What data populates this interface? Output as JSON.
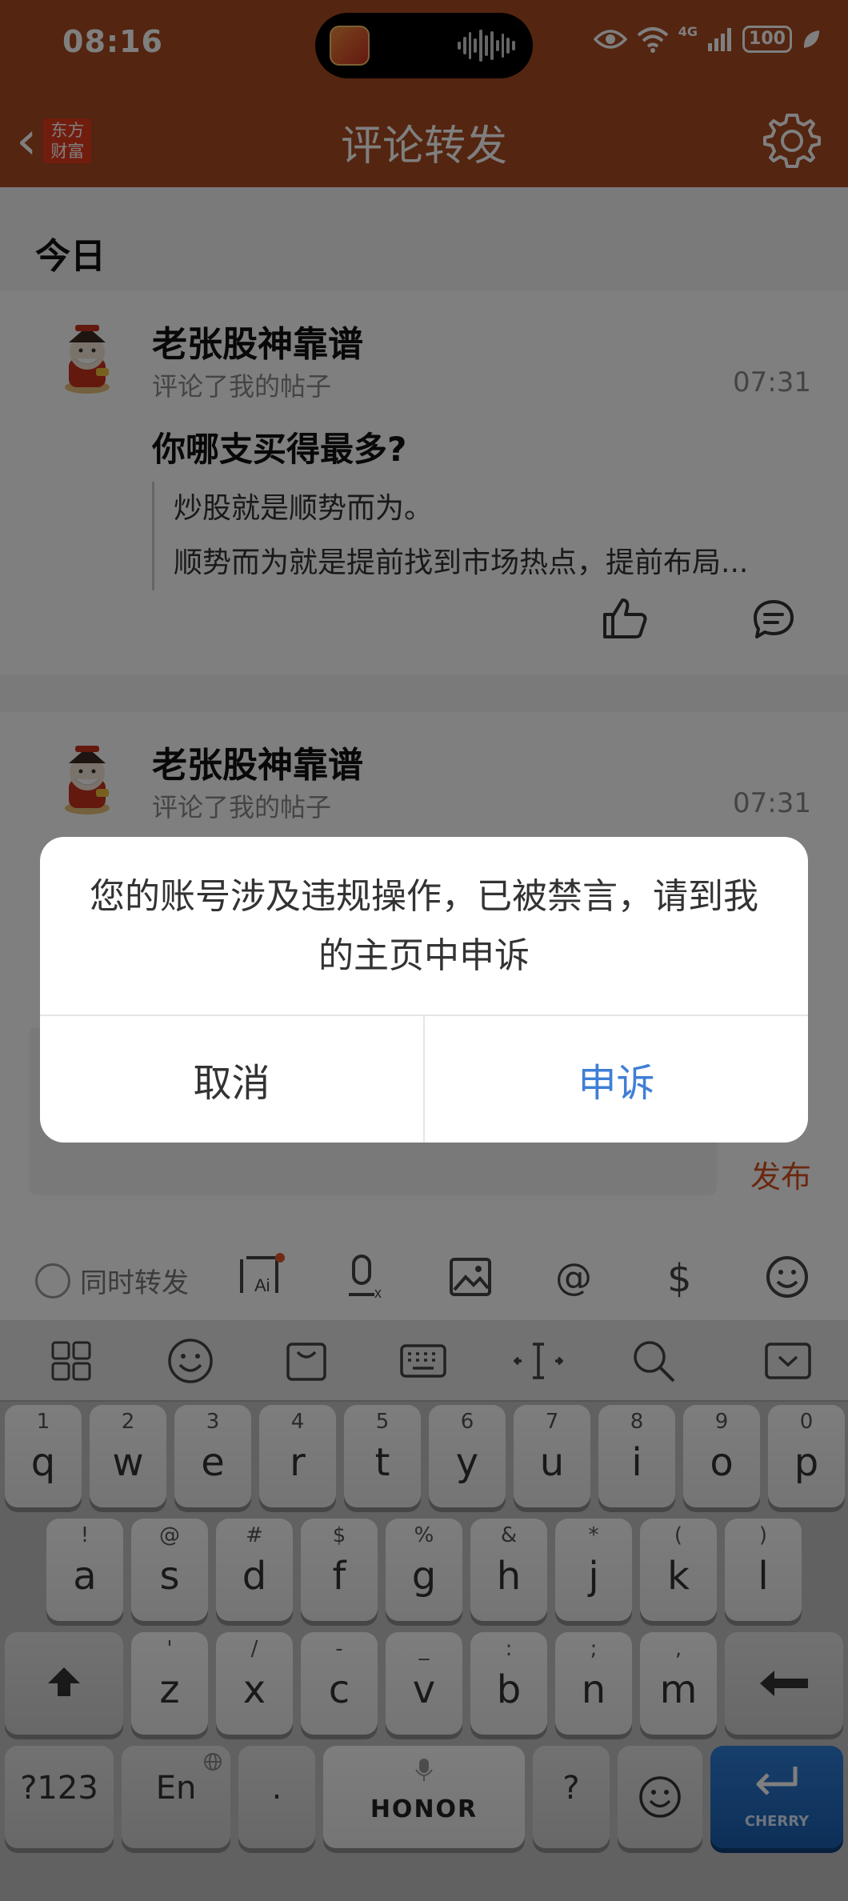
{
  "status": {
    "time": "08:16",
    "network": "4G",
    "battery": "100"
  },
  "header": {
    "title": "评论转发",
    "logo_line1": "东方",
    "logo_line2": "财富"
  },
  "section": {
    "label": "今日"
  },
  "comments": [
    {
      "name": "老张股神靠谱",
      "action": "评论了我的帖子",
      "time": "07:31",
      "post_title": "你哪支买得最多?",
      "quote_line1": "炒股就是顺势而为。",
      "quote_line2": "顺势而为就是提前找到市场热点，提前布局..."
    },
    {
      "name": "老张股神靠谱",
      "action": "评论了我的帖子",
      "time": "07:31"
    }
  ],
  "compose": {
    "publish_label": "发布",
    "sync_label": "同时转发"
  },
  "keyboard": {
    "row1": [
      {
        "hint": "1",
        "key": "q"
      },
      {
        "hint": "2",
        "key": "w"
      },
      {
        "hint": "3",
        "key": "e"
      },
      {
        "hint": "4",
        "key": "r"
      },
      {
        "hint": "5",
        "key": "t"
      },
      {
        "hint": "6",
        "key": "y"
      },
      {
        "hint": "7",
        "key": "u"
      },
      {
        "hint": "8",
        "key": "i"
      },
      {
        "hint": "9",
        "key": "o"
      },
      {
        "hint": "0",
        "key": "p"
      }
    ],
    "row2": [
      {
        "hint": "!",
        "key": "a"
      },
      {
        "hint": "@",
        "key": "s"
      },
      {
        "hint": "#",
        "key": "d"
      },
      {
        "hint": "$",
        "key": "f"
      },
      {
        "hint": "%",
        "key": "g"
      },
      {
        "hint": "&",
        "key": "h"
      },
      {
        "hint": "*",
        "key": "j"
      },
      {
        "hint": "(",
        "key": "k"
      },
      {
        "hint": ")",
        "key": "l"
      }
    ],
    "row3": [
      {
        "hint": "'",
        "key": "z"
      },
      {
        "hint": "/",
        "key": "x"
      },
      {
        "hint": "-",
        "key": "c"
      },
      {
        "hint": "_",
        "key": "v"
      },
      {
        "hint": ":",
        "key": "b"
      },
      {
        "hint": ";",
        "key": "n"
      },
      {
        "hint": ",",
        "key": "m"
      }
    ],
    "num_key": "?123",
    "lang_key": "En",
    "period_key": ".",
    "space_key": "HONOR",
    "question_key": "?",
    "enter_brand": "CHERRY"
  },
  "dialog": {
    "message": "您的账号涉及违规操作，已被禁言，请到我的主页中申诉",
    "cancel_label": "取消",
    "appeal_label": "申诉"
  }
}
